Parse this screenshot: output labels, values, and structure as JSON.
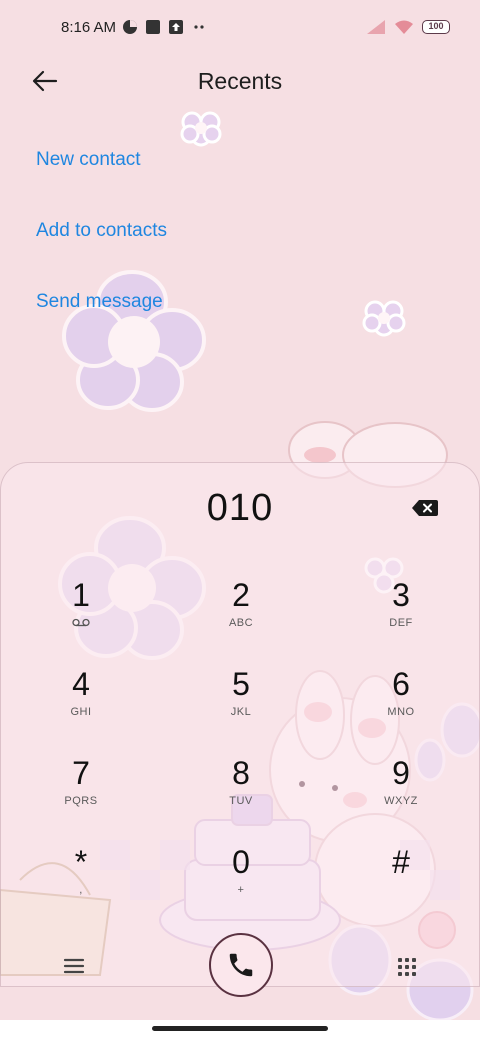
{
  "status_bar": {
    "time": "8:16 AM",
    "battery": "100"
  },
  "header": {
    "title": "Recents"
  },
  "actions": [
    {
      "label": "New contact"
    },
    {
      "label": "Add to contacts"
    },
    {
      "label": "Send message"
    }
  ],
  "dialer": {
    "number": "010",
    "keys": [
      {
        "digit": "1",
        "letters": ""
      },
      {
        "digit": "2",
        "letters": "ABC"
      },
      {
        "digit": "3",
        "letters": "DEF"
      },
      {
        "digit": "4",
        "letters": "GHI"
      },
      {
        "digit": "5",
        "letters": "JKL"
      },
      {
        "digit": "6",
        "letters": "MNO"
      },
      {
        "digit": "7",
        "letters": "PQRS"
      },
      {
        "digit": "8",
        "letters": "TUV"
      },
      {
        "digit": "9",
        "letters": "WXYZ"
      },
      {
        "digit": "*",
        "letters": ","
      },
      {
        "digit": "0",
        "letters": "+"
      },
      {
        "digit": "#",
        "letters": ""
      }
    ]
  },
  "colors": {
    "accent": "#1f86e0",
    "background": "#f6dfe3",
    "call_button_border": "#5a3241"
  },
  "icons": {
    "back": "arrow-left-icon",
    "backspace": "backspace-icon",
    "menu": "menu-icon",
    "call": "phone-icon",
    "dialpad": "dialpad-icon",
    "voicemail": "voicemail-icon"
  }
}
